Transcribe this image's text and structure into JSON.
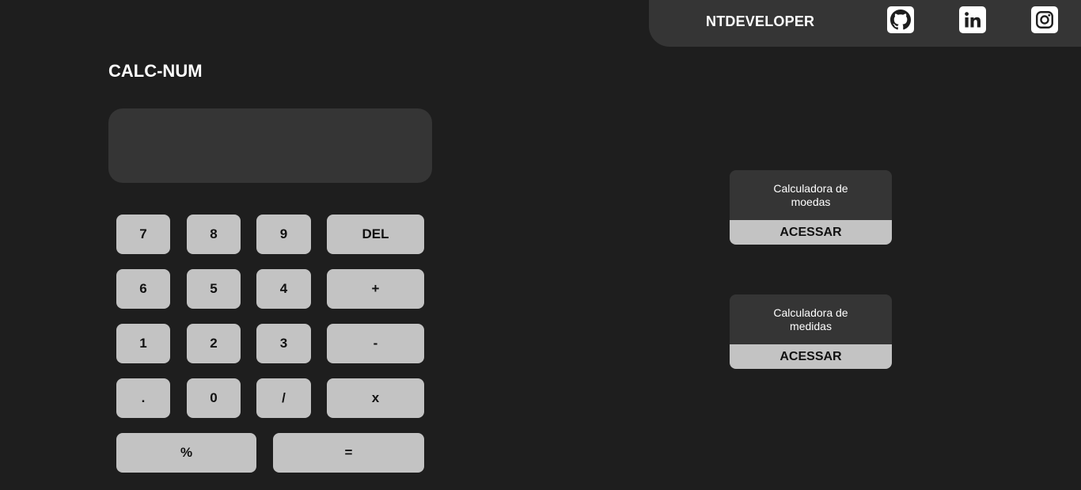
{
  "header": {
    "brand": "NTDEVELOPER",
    "social": [
      {
        "icon": "github-icon"
      },
      {
        "icon": "linkedin-icon"
      },
      {
        "icon": "instagram-icon"
      }
    ]
  },
  "calculator": {
    "title": "CALC-NUM",
    "display_value": "",
    "keys": {
      "k7": "7",
      "k8": "8",
      "k9": "9",
      "del": "DEL",
      "k6": "6",
      "k5": "5",
      "k4": "4",
      "plus": "+",
      "k1": "1",
      "k2": "2",
      "k3": "3",
      "minus": "-",
      "dot": ".",
      "k0": "0",
      "divide": "/",
      "multiply": "x",
      "percent": "%",
      "equals": "="
    }
  },
  "cards": [
    {
      "title": "Calculadora de moedas",
      "button": "ACESSAR"
    },
    {
      "title": "Calculadora de medidas",
      "button": "ACESSAR"
    }
  ],
  "colors": {
    "background": "#1e1e1e",
    "panel": "#353535",
    "key": "#c3c3c3",
    "text_light": "#ffffff",
    "text_dark": "#111111"
  }
}
